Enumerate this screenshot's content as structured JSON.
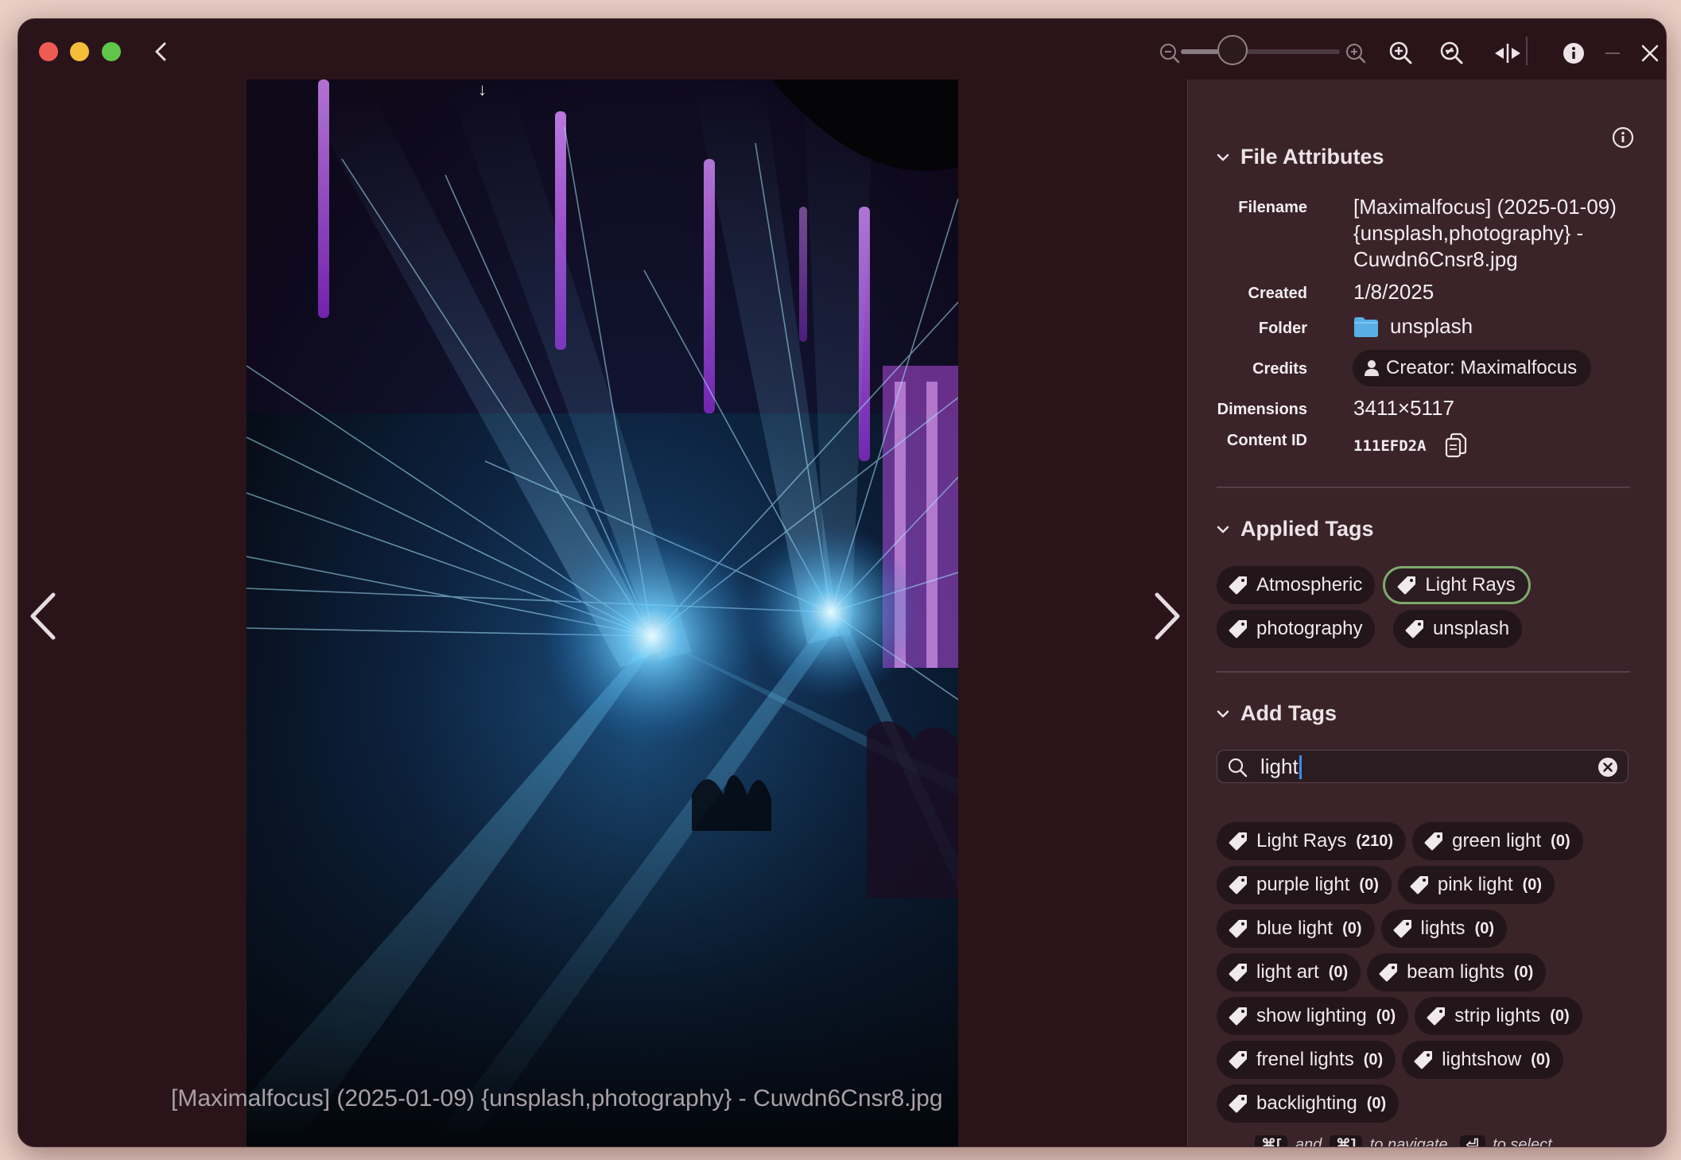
{
  "window": {
    "title": "",
    "zoom_level": 0.25
  },
  "viewer": {
    "caption": "[Maximalfocus] (2025-01-09) {unsplash,photography} - Cuwdn6Cnsr8.jpg",
    "scroll_glyph": "↓"
  },
  "panel": {
    "file_attributes": {
      "heading": "File Attributes",
      "filename_label": "Filename",
      "filename_lines": [
        "[Maximalfocus] (2025-01-09)",
        "{unsplash,photography} -",
        "Cuwdn6Cnsr8.jpg"
      ],
      "created_label": "Created",
      "created_value": "1/8/2025",
      "folder_label": "Folder",
      "folder_value": "unsplash",
      "credits_label": "Credits",
      "credits_value": "Creator: Maximalfocus",
      "dimensions_label": "Dimensions",
      "dimensions_value": "3411×5117",
      "content_id_label": "Content ID",
      "content_id_value": "111EFD2A"
    },
    "applied_tags": {
      "heading": "Applied Tags",
      "tags": [
        {
          "label": "Atmospheric",
          "selected": false
        },
        {
          "label": "Light Rays",
          "selected": true
        },
        {
          "label": "photography",
          "selected": false
        },
        {
          "label": "unsplash",
          "selected": false
        }
      ]
    },
    "add_tags": {
      "heading": "Add Tags",
      "search_value": "light",
      "search_placeholder": "",
      "suggestions": [
        {
          "label": "Light Rays",
          "count": "(210)"
        },
        {
          "label": "green light",
          "count": "(0)"
        },
        {
          "label": "purple light",
          "count": "(0)"
        },
        {
          "label": "pink light",
          "count": "(0)"
        },
        {
          "label": "blue light",
          "count": "(0)"
        },
        {
          "label": "lights",
          "count": "(0)"
        },
        {
          "label": "light art",
          "count": "(0)"
        },
        {
          "label": "beam lights",
          "count": "(0)"
        },
        {
          "label": "show lighting",
          "count": "(0)"
        },
        {
          "label": "strip lights",
          "count": "(0)"
        },
        {
          "label": "frenel lights",
          "count": "(0)"
        },
        {
          "label": "lightshow",
          "count": "(0)"
        },
        {
          "label": "backlighting",
          "count": "(0)"
        }
      ]
    },
    "hint": {
      "key_prev": "⌘[",
      "and": "and",
      "key_next": "⌘]",
      "to_navigate": "to navigate,",
      "key_select": "⏎",
      "to_select": "to select"
    }
  },
  "colors": {
    "window_bg": "#2a1419",
    "panel_bg": "#3a2329",
    "chip_bg": "#22161a",
    "selected_border": "#7daa6c",
    "folder_blue": "#5aaee6",
    "caret_blue": "#3d8bf0"
  },
  "icons": [
    "back-chevron-icon",
    "zoom-out-icon",
    "zoom-in-icon",
    "zoom-fit-icon",
    "zoom-actual-icon",
    "compare-icon",
    "info-icon",
    "minimize-icon",
    "close-icon",
    "prev-arrow-icon",
    "next-arrow-icon",
    "chevron-down-icon",
    "folder-icon",
    "person-icon",
    "copy-icon",
    "tag-icon",
    "search-icon",
    "clear-icon"
  ]
}
